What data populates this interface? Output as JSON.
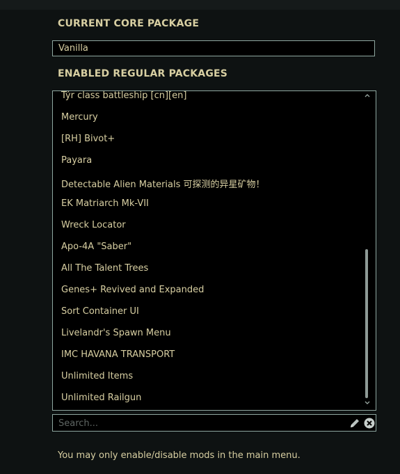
{
  "core": {
    "heading": "CURRENT CORE PACKAGE",
    "value": "Vanilla"
  },
  "regular": {
    "heading": "ENABLED REGULAR PACKAGES",
    "items": [
      "Týr class battleship [cn][en]",
      "Mercury",
      "[RH] Bivot+",
      "Payara",
      "Detectable Alien Materials 可探测的异星矿物！",
      "EK Matriarch Mk-VII",
      "Wreck Locator",
      "Apo-4A \"Saber\"",
      "All The Talent Trees",
      "Genes+ Revived and Expanded",
      "Sort Container UI",
      "Livelandr's Spawn Menu",
      "IMC HAVANA TRANSPORT",
      "Unlimited Items",
      "Unlimited Railgun"
    ]
  },
  "search": {
    "placeholder": "Search..."
  },
  "footer": {
    "message": "You may only enable/disable mods in the main menu."
  },
  "icons": {
    "edit": "pencil-icon",
    "clear": "clear-x-icon",
    "scroll_up": "chevron-up-icon",
    "scroll_down": "chevron-down-icon"
  },
  "colors": {
    "text": "#d8cfa2",
    "border": "#8fa7a0",
    "background": "#0e1212"
  }
}
